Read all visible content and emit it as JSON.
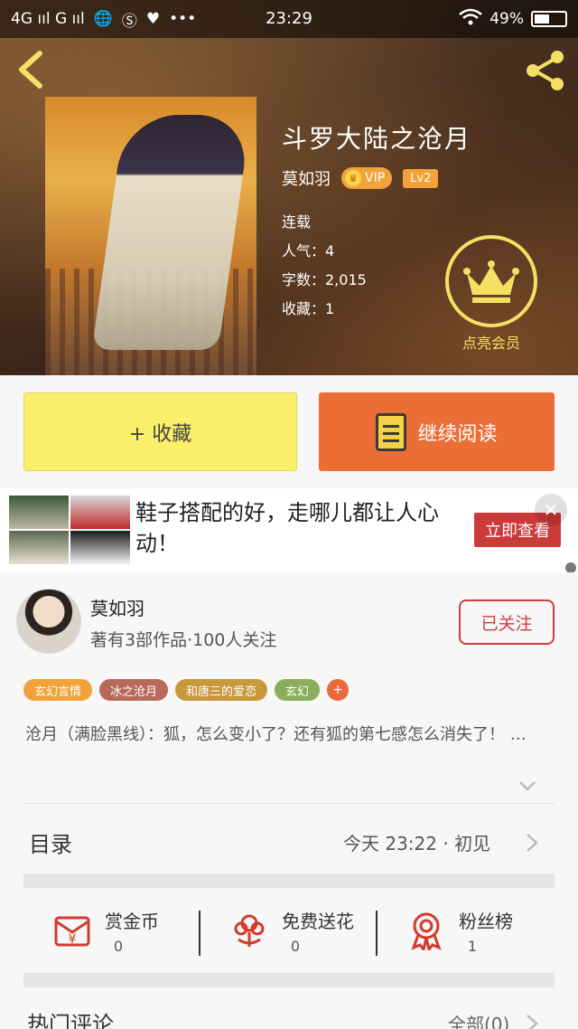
{
  "status_bar": {
    "network": "4G ııl G ııl",
    "time": "23:29",
    "battery": "49%",
    "battery_level": 0.49
  },
  "book": {
    "title": "斗罗大陆之沧月",
    "author": "莫如羽",
    "vip_label": "VIP",
    "level_label": "Lv2",
    "status": "连载",
    "popularity": "人气：4",
    "word_count": "字数：2,015",
    "favorites": "收藏：1"
  },
  "member": {
    "label": "点亮会员"
  },
  "actions": {
    "collect": "+ 收藏",
    "read": "继续阅读"
  },
  "ad": {
    "text": "鞋子搭配的好，走哪儿都让人心动！",
    "cta": "立即查看",
    "close": "✕"
  },
  "author_card": {
    "name": "莫如羽",
    "subtitle": "著有3部作品·100人关注",
    "follow": "已关注"
  },
  "tags": [
    {
      "label": "玄幻言情",
      "color": "#f0a33b"
    },
    {
      "label": "冰之沧月",
      "color": "#b76a5b"
    },
    {
      "label": "和唐三的爱恋",
      "color": "#c8983c"
    },
    {
      "label": "玄幻",
      "color": "#8aae5a"
    }
  ],
  "tag_more": "+",
  "summary": "沧月（满脸黑线）：狐，怎么变小了？还有狐的第七感怎么消失了！ …",
  "toc": {
    "label": "目录",
    "latest": "今天 23:22 · 初见"
  },
  "stats": [
    {
      "label": "赏金币",
      "value": "0",
      "icon": "red-envelope-icon"
    },
    {
      "label": "免费送花",
      "value": "0",
      "icon": "flower-icon"
    },
    {
      "label": "粉丝榜",
      "value": "1",
      "icon": "medal-icon"
    }
  ],
  "hot_comments": {
    "label": "热门评论",
    "all": "全部(0)"
  },
  "colors": {
    "accent_orange": "#ea6e36",
    "accent_yellow": "#fbee6b",
    "follow_red": "#cf3d3d",
    "gold": "#f4e063"
  }
}
